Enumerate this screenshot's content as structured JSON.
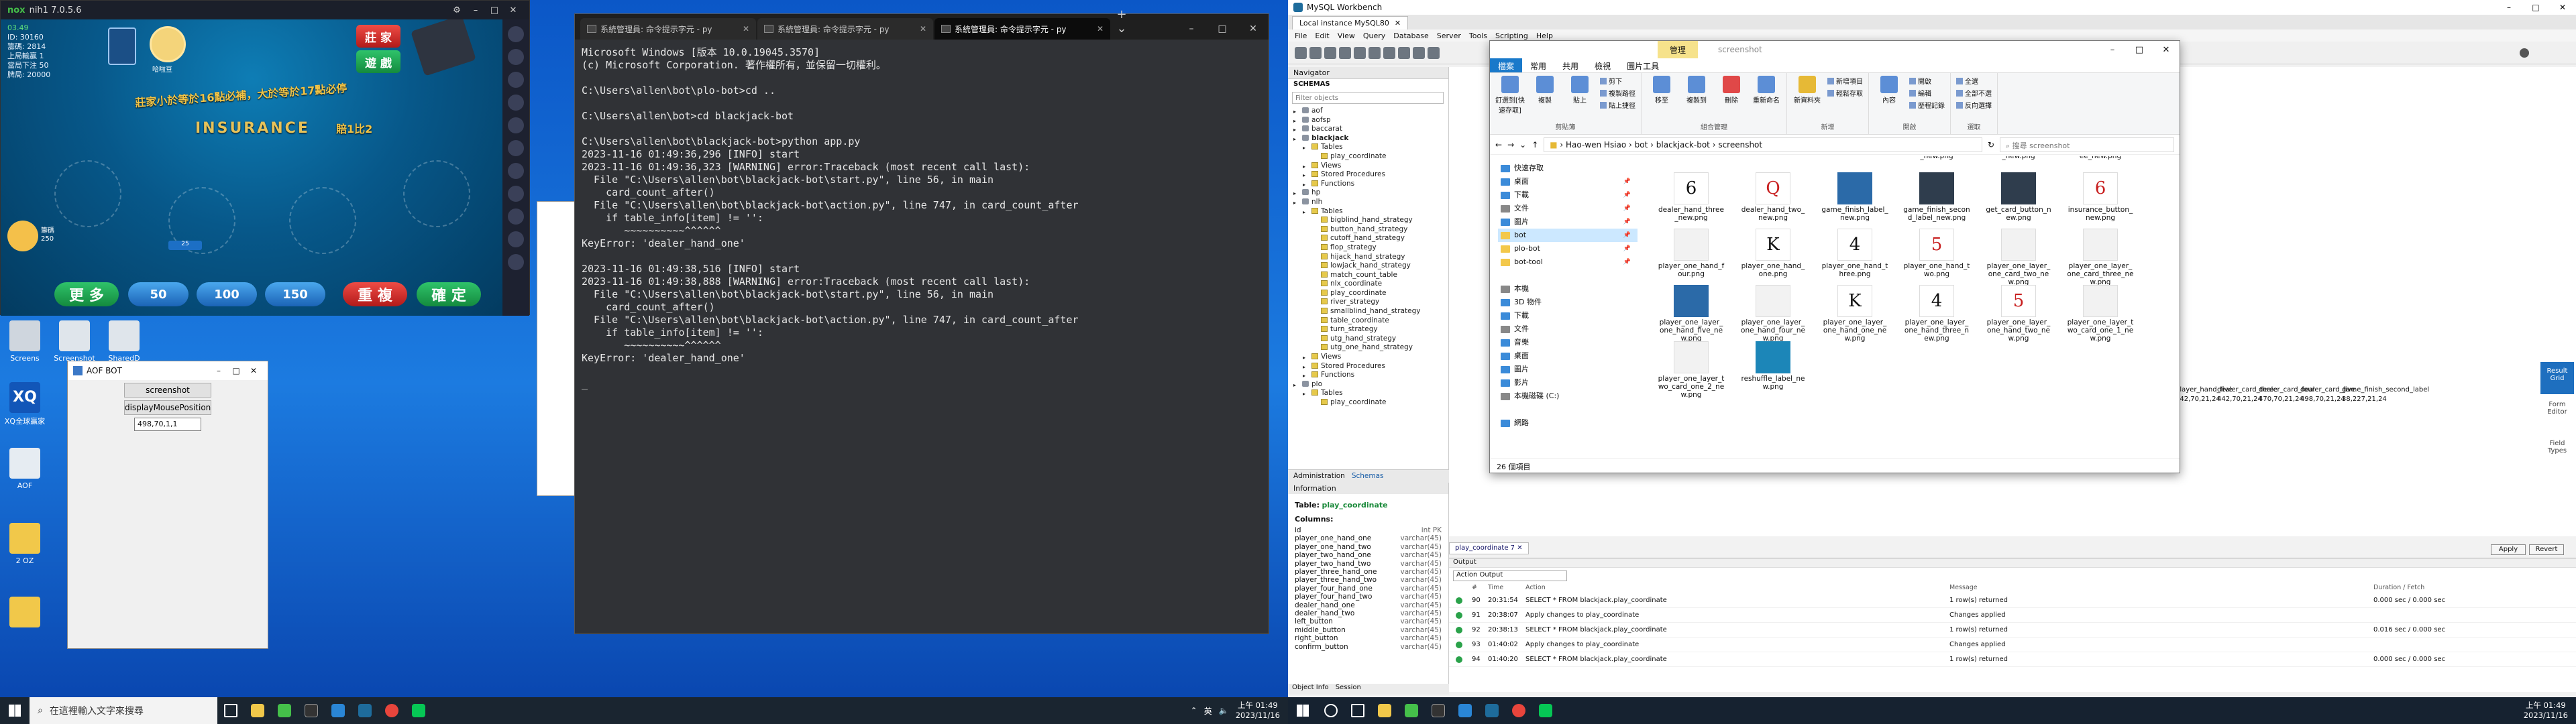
{
  "emulator": {
    "title": "nih1 7.0.5.6",
    "game": {
      "top_left_lines": [
        "ID: 30160",
        "籌碼: 2814",
        "上局輸贏 1",
        "當局下注 50",
        "牌局: 20000"
      ],
      "badge": "03.49",
      "avatar_label": "哈啦豆",
      "player_label": "籌碼",
      "player_chips": "250",
      "arc_text_1": "莊家小於等於16點必補，大於等於17點必停",
      "arc_text_2": "INSURANCE",
      "arc_text_3": "賠1比2",
      "top_btn_1": "莊 家",
      "top_btn_2": "遊 戲",
      "bottom_buttons": [
        "更 多",
        "50",
        "100",
        "150",
        "重 複",
        "確 定"
      ],
      "chip_label": "25"
    }
  },
  "bot_window": {
    "title": "AOF BOT",
    "btn_screenshot": "screenshot",
    "btn_display": "displayMousePosition",
    "readout": "498,70,1,1"
  },
  "desktop_left_icons": [
    "Screens",
    "Screenshot",
    "SharedD",
    "XQ全球贏家",
    "AOF",
    "2 OZ"
  ],
  "terminal": {
    "tabs": [
      "系統管理員: 命令提示字元 - py",
      "系統管理員: 命令提示字元 - py",
      "系統管理員: 命令提示字元 - py"
    ],
    "lines": [
      "Microsoft Windows [版本 10.0.19045.3570]",
      "(c) Microsoft Corporation. 著作權所有，並保留一切權利。",
      "",
      "C:\\Users\\allen\\bot\\plo-bot>cd ..",
      "",
      "C:\\Users\\allen\\bot>cd blackjack-bot",
      "",
      "C:\\Users\\allen\\bot\\blackjack-bot>python app.py",
      "2023-11-16 01:49:36,296 [INFO] start",
      "2023-11-16 01:49:36,323 [WARNING] error:Traceback (most recent call last):",
      "  File \"C:\\Users\\allen\\bot\\blackjack-bot\\start.py\", line 56, in main",
      "    card_count_after()",
      "  File \"C:\\Users\\allen\\bot\\blackjack-bot\\action.py\", line 747, in card_count_after",
      "    if table_info[item] != '':",
      "       ~~~~~~~~~~^^^^^^",
      "KeyError: 'dealer_hand_one'",
      "",
      "2023-11-16 01:49:38,516 [INFO] start",
      "2023-11-16 01:49:38,888 [WARNING] error:Traceback (most recent call last):",
      "  File \"C:\\Users\\allen\\bot\\blackjack-bot\\start.py\", line 56, in main",
      "    card_count_after()",
      "  File \"C:\\Users\\allen\\bot\\blackjack-bot\\action.py\", line 747, in card_count_after",
      "    if table_info[item] != '':",
      "       ~~~~~~~~~~^^^^^^",
      "KeyError: 'dealer_hand_one'",
      "",
      "_"
    ]
  },
  "workbench": {
    "title": "MySQL Workbench",
    "tab": "Local instance MySQL80",
    "menu": [
      "File",
      "Edit",
      "View",
      "Query",
      "Database",
      "Server",
      "Tools",
      "Scripting",
      "Help"
    ],
    "navigator_title": "Navigator",
    "schemas_label": "SCHEMAS",
    "filter_placeholder": "Filter objects",
    "tree": [
      {
        "t": "db",
        "label": "aof"
      },
      {
        "t": "db",
        "label": "aofsp"
      },
      {
        "t": "db",
        "label": "baccarat"
      },
      {
        "t": "db",
        "label": "blackjack"
      },
      {
        "t": "f",
        "label": "Tables"
      },
      {
        "t": "tbl",
        "label": "play_coordinate"
      },
      {
        "t": "f",
        "label": "Views"
      },
      {
        "t": "f",
        "label": "Stored Procedures"
      },
      {
        "t": "f",
        "label": "Functions"
      },
      {
        "t": "db",
        "label": "hp"
      },
      {
        "t": "db",
        "label": "nlh"
      },
      {
        "t": "f",
        "label": "Tables"
      },
      {
        "t": "tbl",
        "label": "bigblind_hand_strategy"
      },
      {
        "t": "tbl",
        "label": "button_hand_strategy"
      },
      {
        "t": "tbl",
        "label": "cutoff_hand_strategy"
      },
      {
        "t": "tbl",
        "label": "flop_strategy"
      },
      {
        "t": "tbl",
        "label": "hijack_hand_strategy"
      },
      {
        "t": "tbl",
        "label": "lowjack_hand_strategy"
      },
      {
        "t": "tbl",
        "label": "match_count_table"
      },
      {
        "t": "tbl",
        "label": "nlx_coordinate"
      },
      {
        "t": "tbl",
        "label": "play_coordinate"
      },
      {
        "t": "tbl",
        "label": "river_strategy"
      },
      {
        "t": "tbl",
        "label": "smallblind_hand_strategy"
      },
      {
        "t": "tbl",
        "label": "table_coordinate"
      },
      {
        "t": "tbl",
        "label": "turn_strategy"
      },
      {
        "t": "tbl",
        "label": "utg_hand_strategy"
      },
      {
        "t": "tbl",
        "label": "utg_one_hand_strategy"
      },
      {
        "t": "f",
        "label": "Views"
      },
      {
        "t": "f",
        "label": "Stored Procedures"
      },
      {
        "t": "f",
        "label": "Functions"
      },
      {
        "t": "db",
        "label": "plo"
      },
      {
        "t": "f",
        "label": "Tables"
      },
      {
        "t": "tbl",
        "label": "play_coordinate"
      }
    ],
    "nav_tabs": [
      "Administration",
      "Schemas"
    ],
    "info_title": "Information",
    "info_table_label": "Table:",
    "info_table_name": "play_coordinate",
    "info_columns_label": "Columns:",
    "info_columns": [
      {
        "n": "id",
        "t": "int PK"
      },
      {
        "n": "player_one_hand_one",
        "t": "varchar(45)"
      },
      {
        "n": "player_one_hand_two",
        "t": "varchar(45)"
      },
      {
        "n": "player_two_hand_one",
        "t": "varchar(45)"
      },
      {
        "n": "player_two_hand_two",
        "t": "varchar(45)"
      },
      {
        "n": "player_three_hand_one",
        "t": "varchar(45)"
      },
      {
        "n": "player_three_hand_two",
        "t": "varchar(45)"
      },
      {
        "n": "player_four_hand_one",
        "t": "varchar(45)"
      },
      {
        "n": "player_four_hand_two",
        "t": "varchar(45)"
      },
      {
        "n": "dealer_hand_one",
        "t": "varchar(45)"
      },
      {
        "n": "dealer_hand_two",
        "t": "varchar(45)"
      },
      {
        "n": "left_button",
        "t": "varchar(45)"
      },
      {
        "n": "middle_button",
        "t": "varchar(45)"
      },
      {
        "n": "right_button",
        "t": "varchar(45)"
      },
      {
        "n": "confirm_button",
        "t": "varchar(45)"
      }
    ],
    "info_tabs": [
      "Object Info",
      "Session"
    ],
    "result_headers": [
      "player_hand_five",
      "dealer_card_three",
      "dealer_card_four",
      "dealer_card_five",
      "game_finish_second_label"
    ],
    "result_values": [
      "442,70,21,24",
      "442,70,21,24",
      "470,70,21,24",
      "498,70,21,24",
      "38,227,21,24"
    ],
    "apply_label": "Apply",
    "revert_label": "Revert",
    "right_side_labels": [
      "Result Grid",
      "Form Editor",
      "Field Types"
    ],
    "query_tab": "play_coordinate 7",
    "output_label": "Output",
    "output_select": "Action Output",
    "output_headers": [
      "#",
      "Time",
      "Action",
      "Message",
      "Duration / Fetch"
    ],
    "output_rows": [
      {
        "n": "90",
        "time": "20:31:54",
        "action": "SELECT * FROM blackjack.play_coordinate",
        "msg": "1 row(s) returned",
        "dur": "0.000 sec / 0.000 sec"
      },
      {
        "n": "91",
        "time": "20:38:07",
        "action": "Apply changes to play_coordinate",
        "msg": "Changes applied",
        "dur": ""
      },
      {
        "n": "92",
        "time": "20:38:13",
        "action": "SELECT * FROM blackjack.play_coordinate",
        "msg": "1 row(s) returned",
        "dur": "0.016 sec / 0.000 sec"
      },
      {
        "n": "93",
        "time": "01:40:02",
        "action": "Apply changes to play_coordinate",
        "msg": "Changes applied",
        "dur": ""
      },
      {
        "n": "94",
        "time": "01:40:20",
        "action": "SELECT * FROM blackjack.play_coordinate",
        "msg": "1 row(s) returned",
        "dur": "0.000 sec / 0.000 sec"
      }
    ]
  },
  "explorer": {
    "context_tab": "管理",
    "folder_name": "screenshot",
    "ribbon_tabs": [
      "檔案",
      "常用",
      "共用",
      "檢視",
      "圖片工具"
    ],
    "ribbon_groups": [
      {
        "label": "剪貼簿",
        "items": [
          "釘選到[快速存取]",
          "複製",
          "貼上"
        ],
        "small": [
          "剪下",
          "複製路徑",
          "貼上捷徑"
        ]
      },
      {
        "label": "組合管理",
        "items": [
          "移至",
          "複製到",
          "刪除",
          "重新命名"
        ],
        "small": []
      },
      {
        "label": "新增",
        "items": [
          "新資料夾"
        ],
        "small": [
          "新增項目",
          "輕鬆存取"
        ]
      },
      {
        "label": "開啟",
        "items": [
          "內容"
        ],
        "small": [
          "開啟",
          "編輯",
          "歷程記錄"
        ]
      },
      {
        "label": "選取",
        "items": [],
        "small": [
          "全選",
          "全部不選",
          "反向選擇"
        ]
      }
    ],
    "address_parts": [
      "Hao-wen Hsiao",
      "bot",
      "blackjack-bot",
      "screenshot"
    ],
    "search_placeholder": "搜尋 screenshot",
    "nav_items": [
      {
        "label": "快速存取",
        "icon": "blue",
        "pin": ""
      },
      {
        "label": "桌面",
        "icon": "blue",
        "pin": "📌"
      },
      {
        "label": "下載",
        "icon": "blue",
        "pin": "📌"
      },
      {
        "label": "文件",
        "icon": "gray",
        "pin": "📌"
      },
      {
        "label": "圖片",
        "icon": "blue",
        "pin": "📌"
      },
      {
        "label": "bot",
        "icon": "yel",
        "pin": "📌",
        "sel": true
      },
      {
        "label": "plo-bot",
        "icon": "yel",
        "pin": "📌"
      },
      {
        "label": "bot-tool",
        "icon": "yel",
        "pin": "📌"
      },
      {
        "label": "",
        "icon": "",
        "pin": ""
      },
      {
        "label": "本機",
        "icon": "gray",
        "pin": ""
      },
      {
        "label": "3D 物件",
        "icon": "blue",
        "pin": ""
      },
      {
        "label": "下載",
        "icon": "blue",
        "pin": ""
      },
      {
        "label": "文件",
        "icon": "gray",
        "pin": ""
      },
      {
        "label": "音樂",
        "icon": "blue",
        "pin": ""
      },
      {
        "label": "桌面",
        "icon": "blue",
        "pin": ""
      },
      {
        "label": "圖片",
        "icon": "blue",
        "pin": ""
      },
      {
        "label": "影片",
        "icon": "blue",
        "pin": ""
      },
      {
        "label": "本機磁碟 (C:)",
        "icon": "gray",
        "pin": ""
      },
      {
        "label": "",
        "icon": "",
        "pin": ""
      },
      {
        "label": "網路",
        "icon": "blue",
        "pin": ""
      }
    ],
    "files": [
      {
        "name": "",
        "suffix": "_new.png",
        "thumb": "white",
        "glyph": ""
      },
      {
        "name": "",
        "suffix": "_new.png",
        "thumb": "white",
        "glyph": ""
      },
      {
        "name": "",
        "suffix": "ee_new.png",
        "thumb": "white",
        "glyph": ""
      },
      {
        "name": "dealer_hand_three_new.png",
        "thumb": "white",
        "glyph": "6"
      },
      {
        "name": "dealer_hand_two_new.png",
        "thumb": "red",
        "glyph": "Q"
      },
      {
        "name": "game_finish_label_new.png",
        "thumb": "blue",
        "glyph": ""
      },
      {
        "name": "game_finish_second_label_new.png",
        "thumb": "dark",
        "glyph": ""
      },
      {
        "name": "get_card_button_new.png",
        "thumb": "dark",
        "glyph": ""
      },
      {
        "name": "insurance_button_new.png",
        "thumb": "red",
        "glyph": "6"
      },
      {
        "name": "player_one_hand_four.png",
        "thumb": "gray",
        "glyph": ""
      },
      {
        "name": "player_one_hand_one.png",
        "thumb": "white",
        "glyph": "K"
      },
      {
        "name": "player_one_hand_three.png",
        "thumb": "white",
        "glyph": "4"
      },
      {
        "name": "player_one_hand_two.png",
        "thumb": "red",
        "glyph": "5"
      },
      {
        "name": "player_one_layer_one_card_two_new.png",
        "thumb": "gray",
        "glyph": ""
      },
      {
        "name": "player_one_layer_one_card_three_new.png",
        "thumb": "gray",
        "glyph": ""
      },
      {
        "name": "player_one_layer_one_hand_five_new.png",
        "thumb": "blue",
        "glyph": ""
      },
      {
        "name": "player_one_layer_one_hand_four_new.png",
        "thumb": "gray",
        "glyph": ""
      },
      {
        "name": "player_one_layer_one_hand_one_new.png",
        "thumb": "white",
        "glyph": "K"
      },
      {
        "name": "player_one_layer_one_hand_three_new.png",
        "thumb": "white",
        "glyph": "4"
      },
      {
        "name": "player_one_layer_one_hand_two_new.png",
        "thumb": "red",
        "glyph": "5"
      },
      {
        "name": "player_one_layer_two_card_one_1_new.png",
        "thumb": "gray",
        "glyph": ""
      },
      {
        "name": "player_one_layer_two_card_one_2_new.png",
        "thumb": "gray",
        "glyph": ""
      },
      {
        "name": "reshuffle_label_new.png",
        "thumb": "cyan",
        "glyph": ""
      }
    ],
    "status": "26 個項目"
  },
  "taskbar_left": {
    "search_placeholder": "在這裡輸入文字來搜尋",
    "time": "上午 01:49",
    "date": "2023/11/16",
    "ime": "英"
  },
  "taskbar_right": {
    "time": "上午 01:49",
    "date": "2023/11/16"
  },
  "colors": {
    "terminal_bg": "#303236",
    "explorer_file_tab": "#1979ca",
    "game_green": "#2fc36a",
    "game_red": "#b21a1a",
    "game_blue": "#1b63b6"
  }
}
